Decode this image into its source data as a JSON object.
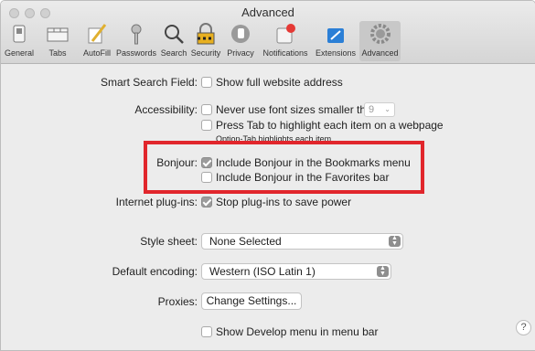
{
  "window": {
    "title": "Advanced"
  },
  "toolbar": {
    "items": [
      {
        "label": "General",
        "icon": "general-switch-icon"
      },
      {
        "label": "Tabs",
        "icon": "tabs-icon"
      },
      {
        "label": "AutoFill",
        "icon": "pencil-icon"
      },
      {
        "label": "Passwords",
        "icon": "key-icon"
      },
      {
        "label": "Search",
        "icon": "magnifier-icon"
      },
      {
        "label": "Security",
        "icon": "padlock-icon"
      },
      {
        "label": "Privacy",
        "icon": "hand-icon"
      },
      {
        "label": "Notifications",
        "icon": "notification-badge-icon"
      },
      {
        "label": "Extensions",
        "icon": "puzzle-icon"
      },
      {
        "label": "Advanced",
        "icon": "gear-icon"
      }
    ],
    "selected": "Advanced"
  },
  "settings": {
    "smart_search": {
      "label": "Smart Search Field:",
      "option": "Show full website address",
      "checked": false
    },
    "accessibility": {
      "label": "Accessibility:",
      "font_option": "Never use font sizes smaller than",
      "font_size_value": "9",
      "font_checked": false,
      "tab_option": "Press Tab to highlight each item on a webpage",
      "tab_checked": false,
      "tab_note": "Option-Tab highlights each item."
    },
    "bonjour": {
      "label": "Bonjour:",
      "bookmarks_option": "Include Bonjour in the Bookmarks menu",
      "bookmarks_checked": true,
      "favorites_option": "Include Bonjour in the Favorites bar",
      "favorites_checked": false
    },
    "plugins": {
      "label": "Internet plug-ins:",
      "option": "Stop plug-ins to save power",
      "checked": true
    },
    "style_sheet": {
      "label": "Style sheet:",
      "value": "None Selected"
    },
    "encoding": {
      "label": "Default encoding:",
      "value": "Western (ISO Latin 1)"
    },
    "proxies": {
      "label": "Proxies:",
      "button": "Change Settings..."
    },
    "develop": {
      "option": "Show Develop menu in menu bar",
      "checked": false
    }
  },
  "help": {
    "label": "?"
  },
  "colors": {
    "highlight_border": "#e1262c",
    "checkbox_checked": "#9b9b9b"
  }
}
